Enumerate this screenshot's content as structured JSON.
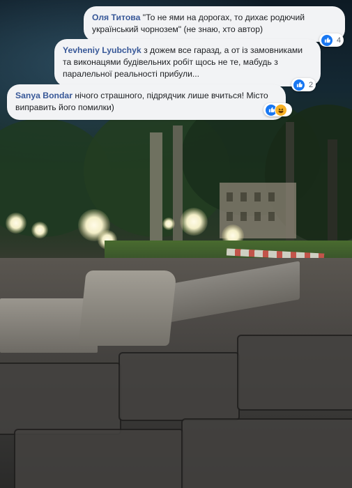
{
  "comments": [
    {
      "author": "Оля Титова",
      "text": "\"То не ями на дорогах, то дихає родючий український чорнозем\" (не знаю, хто автор)",
      "reactions": {
        "icons": [
          "like-icon"
        ],
        "count": "4"
      }
    },
    {
      "author": "Yevheniy Lyubchyk",
      "text": "з дожем все гаразд, а от із замовниками та виконацями будівельних робіт щось не те, мабудь з паралельної реальності прибули...",
      "reactions": {
        "icons": [
          "like-icon"
        ],
        "count": "2"
      }
    },
    {
      "author": "Sanya Bondar",
      "text": "нічого страшного, підрядчик лише вчиться! Місто виправить його помилки)",
      "reactions": {
        "icons": [
          "like-icon",
          "haha-icon"
        ],
        "count": ""
      }
    }
  ],
  "colors": {
    "author": "#385898",
    "bubble": "#f2f3f5",
    "like": "#1877f2",
    "haha": "#f7b125"
  }
}
